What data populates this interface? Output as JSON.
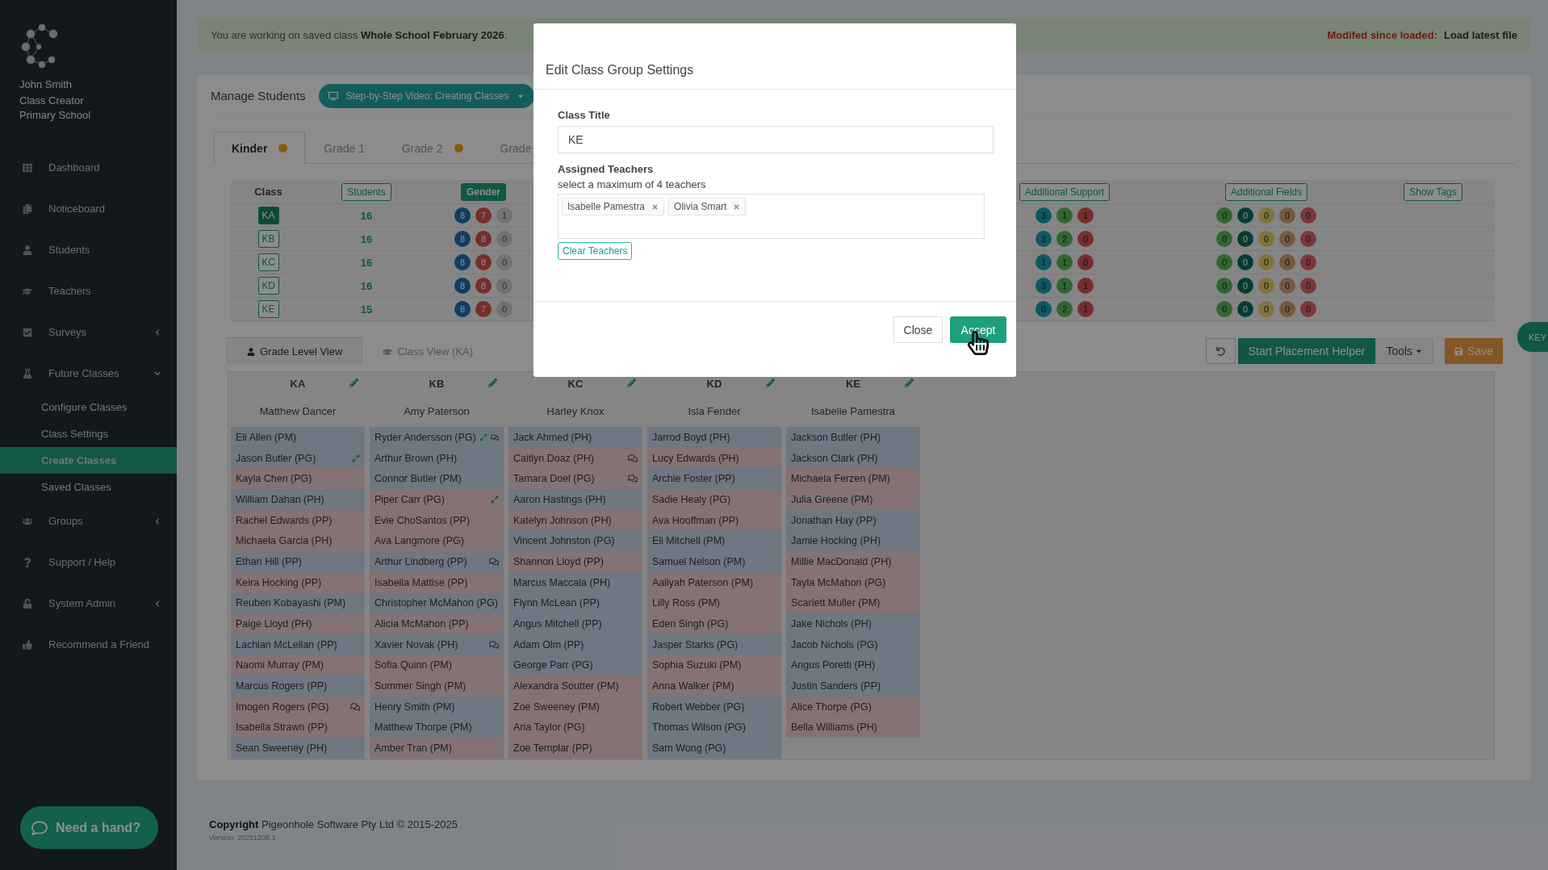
{
  "sidebar": {
    "user": "John Smith",
    "school": "Class Creator Primary School",
    "items": [
      {
        "label": "Dashboard",
        "kind": "link"
      },
      {
        "label": "Noticeboard",
        "kind": "link"
      },
      {
        "label": "Students",
        "kind": "link"
      },
      {
        "label": "Teachers",
        "kind": "link"
      },
      {
        "label": "Surveys",
        "kind": "menu",
        "expanded": false
      },
      {
        "label": "Future Classes",
        "kind": "menu",
        "expanded": true,
        "children": [
          {
            "label": "Configure Classes",
            "selected": false
          },
          {
            "label": "Class Settings",
            "selected": false
          },
          {
            "label": "Create Classes",
            "selected": true
          },
          {
            "label": "Saved Classes",
            "selected": false
          }
        ]
      },
      {
        "label": "Groups",
        "kind": "menu",
        "expanded": false
      },
      {
        "label": "Support / Help",
        "kind": "link"
      },
      {
        "label": "System Admin",
        "kind": "menu",
        "expanded": false
      },
      {
        "label": "Recommend a Friend",
        "kind": "link"
      }
    ],
    "help_button": "Need a hand?"
  },
  "banner": {
    "message": "You are working on saved class **Whole School February 2026**.",
    "modified": "Modifed since loaded:",
    "load_link": "Load latest file"
  },
  "panel": {
    "title": "Manage Students",
    "video_button": "Step-by-Step Video: Creating Classes"
  },
  "grade_tabs": [
    {
      "label": "Kinder",
      "selected": true,
      "alert": true
    },
    {
      "label": "Grade 1",
      "selected": false,
      "alert": false
    },
    {
      "label": "Grade 2",
      "selected": false,
      "alert": true
    },
    {
      "label": "Grade",
      "selected": false,
      "alert": false
    }
  ],
  "summary": {
    "class_header": "Class",
    "headers": [
      {
        "label": "Students",
        "selected": false
      },
      {
        "label": "Gender",
        "selected": true
      },
      {
        "label": "Additional Support",
        "selected": false
      },
      {
        "label": "Additional Fields",
        "selected": false
      },
      {
        "label": "Show Tags",
        "selected": false
      }
    ],
    "rows": [
      {
        "name": "KA",
        "selected": true,
        "students": "16",
        "gender": [
          "8",
          "7",
          "1"
        ],
        "support": [
          "3",
          "1",
          "1"
        ],
        "fields": [
          "0",
          "0",
          "0",
          "0",
          "0"
        ]
      },
      {
        "name": "KB",
        "selected": false,
        "students": "16",
        "gender": [
          "8",
          "8",
          "0"
        ],
        "support": [
          "3",
          "2",
          "0"
        ],
        "fields": [
          "0",
          "0",
          "0",
          "0",
          "0"
        ]
      },
      {
        "name": "KC",
        "selected": false,
        "students": "16",
        "gender": [
          "8",
          "8",
          "0"
        ],
        "support": [
          "1",
          "1",
          "0"
        ],
        "fields": [
          "0",
          "0",
          "0",
          "0",
          "0"
        ]
      },
      {
        "name": "KD",
        "selected": false,
        "students": "16",
        "gender": [
          "8",
          "8",
          "0"
        ],
        "support": [
          "3",
          "1",
          "1"
        ],
        "fields": [
          "0",
          "0",
          "0",
          "0",
          "0"
        ]
      },
      {
        "name": "KE",
        "selected": false,
        "students": "15",
        "gender": [
          "8",
          "7",
          "0"
        ],
        "support": [
          "0",
          "2",
          "1"
        ],
        "fields": [
          "0",
          "0",
          "0",
          "0",
          "0"
        ]
      }
    ]
  },
  "view_tabs": [
    {
      "label": "Grade Level View",
      "selected": true
    },
    {
      "label": "Class View (KA)",
      "selected": false
    }
  ],
  "toolbar": {
    "helper": "Start Placement Helper",
    "tools": "Tools",
    "save": "Save"
  },
  "key_tab": "KEY",
  "classes": [
    {
      "code": "KA",
      "teacher": "Matthew Dancer",
      "students": [
        {
          "name": "Eli Allen (PM)",
          "color": "#6e7782",
          "kind": "plain"
        },
        {
          "name": "Jason Butler (PG)",
          "color": "#6e7782",
          "kind": "moved"
        },
        {
          "name": "Kayla Chen (PG)",
          "color": "#847274",
          "kind": "plain"
        },
        {
          "name": "William Dahan (PH)",
          "color": "#6e7782",
          "kind": "plain"
        },
        {
          "name": "Rachel Edwards (PP)",
          "color": "#847274",
          "kind": "plain"
        },
        {
          "name": "Michaela Garcia (PH)",
          "color": "#847274",
          "kind": "plain"
        },
        {
          "name": "Ethan Hill (PP)",
          "color": "#6e7782",
          "kind": "plain"
        },
        {
          "name": "Keira Hocking (PP)",
          "color": "#847274",
          "kind": "plain"
        },
        {
          "name": "Reuben Kobayashi (PM)",
          "color": "#6e7782",
          "kind": "plain"
        },
        {
          "name": "Paige Lloyd (PH)",
          "color": "#847274",
          "kind": "plain"
        },
        {
          "name": "Lachlan McLellan (PP)",
          "color": "#6e7782",
          "kind": "plain"
        },
        {
          "name": "Naomi Murray (PM)",
          "color": "#847274",
          "kind": "plain"
        },
        {
          "name": "Marcus Rogers (PP)",
          "color": "#6e7782",
          "kind": "plain"
        },
        {
          "name": "Imogen Rogers (PG)",
          "color": "#847274",
          "kind": "note"
        },
        {
          "name": "Isabella Strawn (PP)",
          "color": "#847274",
          "kind": "plain"
        },
        {
          "name": "Sean Sweeney (PH)",
          "color": "#6e7782",
          "kind": "plain"
        }
      ]
    },
    {
      "code": "KB",
      "teacher": "Amy Paterson",
      "students": [
        {
          "name": "Ryder Andersson (PG)",
          "color": "#6e7782",
          "kind": "moved-note"
        },
        {
          "name": "Arthur Brown (PH)",
          "color": "#6e7782",
          "kind": "plain"
        },
        {
          "name": "Connor Butler (PM)",
          "color": "#6e7782",
          "kind": "plain"
        },
        {
          "name": "Piper Carr (PG)",
          "color": "#847274",
          "kind": "moved"
        },
        {
          "name": "Evie ChoSantos (PP)",
          "color": "#847274",
          "kind": "plain"
        },
        {
          "name": "Ava Langmore (PG)",
          "color": "#847274",
          "kind": "plain"
        },
        {
          "name": "Arthur Lindberg (PP)",
          "color": "#6e7782",
          "kind": "note"
        },
        {
          "name": "Isabella Mattise (PP)",
          "color": "#847274",
          "kind": "plain"
        },
        {
          "name": "Christopher McMahon (PG)",
          "color": "#6e7782",
          "kind": "plain"
        },
        {
          "name": "Alicia McMahon (PP)",
          "color": "#847274",
          "kind": "plain"
        },
        {
          "name": "Xavier Novak (PH)",
          "color": "#6e7782",
          "kind": "note"
        },
        {
          "name": "Sofia Quinn (PM)",
          "color": "#847274",
          "kind": "plain"
        },
        {
          "name": "Summer Singh (PM)",
          "color": "#847274",
          "kind": "plain"
        },
        {
          "name": "Henry Smith (PM)",
          "color": "#6e7782",
          "kind": "plain"
        },
        {
          "name": "Matthew Thorpe (PM)",
          "color": "#6e7782",
          "kind": "plain"
        },
        {
          "name": "Amber Tran (PM)",
          "color": "#847274",
          "kind": "plain"
        }
      ]
    },
    {
      "code": "KC",
      "teacher": "Harley Knox",
      "students": [
        {
          "name": "Jack Ahmed (PH)",
          "color": "#6e7782",
          "kind": "plain"
        },
        {
          "name": "Caitlyn Doaz (PH)",
          "color": "#847274",
          "kind": "note"
        },
        {
          "name": "Tamara Doel (PG)",
          "color": "#847274",
          "kind": "note"
        },
        {
          "name": "Aaron Hastings (PH)",
          "color": "#6e7782",
          "kind": "plain"
        },
        {
          "name": "Katelyn Johnson (PH)",
          "color": "#847274",
          "kind": "plain"
        },
        {
          "name": "Vincent Johnston (PG)",
          "color": "#6e7782",
          "kind": "plain"
        },
        {
          "name": "Shannon Lloyd (PP)",
          "color": "#847274",
          "kind": "plain"
        },
        {
          "name": "Marcus Maccala (PH)",
          "color": "#6e7782",
          "kind": "plain"
        },
        {
          "name": "Flynn McLean (PP)",
          "color": "#6e7782",
          "kind": "plain"
        },
        {
          "name": "Angus Mitchell (PP)",
          "color": "#6e7782",
          "kind": "plain"
        },
        {
          "name": "Adam Olm (PP)",
          "color": "#6e7782",
          "kind": "plain"
        },
        {
          "name": "George Parr (PG)",
          "color": "#6e7782",
          "kind": "plain"
        },
        {
          "name": "Alexandra Soutter (PM)",
          "color": "#847274",
          "kind": "plain"
        },
        {
          "name": "Zoe Sweeney (PM)",
          "color": "#847274",
          "kind": "plain"
        },
        {
          "name": "Aria Taylor (PG)",
          "color": "#847274",
          "kind": "plain"
        },
        {
          "name": "Zoe Templar (PP)",
          "color": "#847274",
          "kind": "plain"
        }
      ]
    },
    {
      "code": "KD",
      "teacher": "Isla Fender",
      "students": [
        {
          "name": "Jarrod Boyd (PH)",
          "color": "#6e7782",
          "kind": "plain"
        },
        {
          "name": "Lucy Edwards (PH)",
          "color": "#847274",
          "kind": "plain"
        },
        {
          "name": "Archie Foster (PP)",
          "color": "#6e7782",
          "kind": "plain"
        },
        {
          "name": "Sadie Healy (PG)",
          "color": "#847274",
          "kind": "plain"
        },
        {
          "name": "Ava Hooffman (PP)",
          "color": "#847274",
          "kind": "plain"
        },
        {
          "name": "Eli Mitchell (PM)",
          "color": "#6e7782",
          "kind": "plain"
        },
        {
          "name": "Samuel Nelson (PM)",
          "color": "#6e7782",
          "kind": "plain"
        },
        {
          "name": "Aaliyah Paterson (PM)",
          "color": "#847274",
          "kind": "plain"
        },
        {
          "name": "Lilly Ross (PM)",
          "color": "#847274",
          "kind": "plain"
        },
        {
          "name": "Eden Singh (PG)",
          "color": "#847274",
          "kind": "plain"
        },
        {
          "name": "Jasper Starks (PG)",
          "color": "#6e7782",
          "kind": "plain"
        },
        {
          "name": "Sophia Suzuki (PM)",
          "color": "#847274",
          "kind": "plain"
        },
        {
          "name": "Anna Walker (PM)",
          "color": "#847274",
          "kind": "plain"
        },
        {
          "name": "Robert Webber (PG)",
          "color": "#6e7782",
          "kind": "plain"
        },
        {
          "name": "Thomas Wilson (PG)",
          "color": "#6e7782",
          "kind": "plain"
        },
        {
          "name": "Sam Wong (PG)",
          "color": "#6e7782",
          "kind": "plain"
        }
      ]
    },
    {
      "code": "KE",
      "teacher": "Isabelle Pamestra",
      "students": [
        {
          "name": "Jackson Butler (PH)",
          "color": "#6e7782",
          "kind": "plain"
        },
        {
          "name": "Jackson Clark (PH)",
          "color": "#6e7782",
          "kind": "plain"
        },
        {
          "name": "Michaela Ferzen (PM)",
          "color": "#847274",
          "kind": "plain"
        },
        {
          "name": "Julia Greene (PM)",
          "color": "#847274",
          "kind": "plain"
        },
        {
          "name": "Jonathan Hay (PP)",
          "color": "#6e7782",
          "kind": "plain"
        },
        {
          "name": "Jamie Hocking (PH)",
          "color": "#6e7782",
          "kind": "plain"
        },
        {
          "name": "Millie MacDonald (PH)",
          "color": "#847274",
          "kind": "plain"
        },
        {
          "name": "Tayla McMahon (PG)",
          "color": "#847274",
          "kind": "plain"
        },
        {
          "name": "Scarlett Muller (PM)",
          "color": "#847274",
          "kind": "plain"
        },
        {
          "name": "Jake Nichols (PH)",
          "color": "#6e7782",
          "kind": "plain"
        },
        {
          "name": "Jacob Nichols (PG)",
          "color": "#6e7782",
          "kind": "plain"
        },
        {
          "name": "Angus Poretti (PH)",
          "color": "#6e7782",
          "kind": "plain"
        },
        {
          "name": "Justin Sanders (PP)",
          "color": "#6e7782",
          "kind": "plain"
        },
        {
          "name": "Alice Thorpe (PG)",
          "color": "#847274",
          "kind": "plain"
        },
        {
          "name": "Bella Williams (PH)",
          "color": "#847274",
          "kind": "plain"
        }
      ]
    }
  ],
  "footer": {
    "copyright": "**Copyright** Pigeonhole Software Pty Ltd © 2015-2025",
    "version": "Version: 20251208.1"
  },
  "modal": {
    "title": "Edit Class Group Settings",
    "class_title_label": "Class Title",
    "class_title_value": "KE",
    "teachers_label": "Assigned Teachers",
    "teachers_hint": "select a maximum of 4 teachers",
    "teachers": [
      "Isabelle Pamestra",
      "Olivia Smart"
    ],
    "clear_button": "Clear Teachers",
    "close_button": "Close",
    "accept_button": "Accept"
  }
}
